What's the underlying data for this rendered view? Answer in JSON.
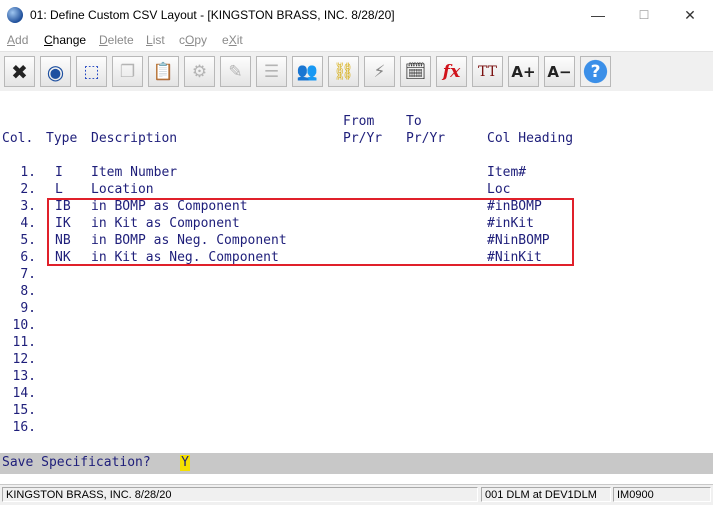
{
  "window": {
    "title": "01: Define Custom CSV Layout - [KINGSTON BRASS, INC. 8/28/20]",
    "minimize": "—",
    "maximize": "☐",
    "close": "✕"
  },
  "menu": [
    {
      "label": "Add",
      "active": false
    },
    {
      "label": "Change",
      "active": true
    },
    {
      "label": "Delete",
      "active": false
    },
    {
      "label": "List",
      "active": false
    },
    {
      "label": "cOpy",
      "active": false
    },
    {
      "label": "eXit",
      "active": false
    }
  ],
  "toolbar": [
    {
      "name": "exit-x-icon",
      "glyph": "✖"
    },
    {
      "name": "globe-icon",
      "glyph": "◉"
    },
    {
      "name": "select-box-icon",
      "glyph": "⬚"
    },
    {
      "name": "copy-icon",
      "glyph": "❐"
    },
    {
      "name": "paste-icon",
      "glyph": "📋"
    },
    {
      "name": "settings-gear-icon",
      "glyph": "⚙"
    },
    {
      "name": "edit-icon",
      "glyph": "✎"
    },
    {
      "name": "list-icon",
      "glyph": "☰"
    },
    {
      "name": "users-icon",
      "glyph": "👥"
    },
    {
      "name": "link-chain-icon",
      "glyph": "⛓"
    },
    {
      "name": "lightning-icon",
      "glyph": "⚡"
    },
    {
      "name": "calendar-edit-icon",
      "glyph": "🗓"
    },
    {
      "name": "function-fx-icon",
      "glyph": "fx"
    },
    {
      "name": "text-size-icon",
      "glyph": "TT"
    },
    {
      "name": "font-increase-icon",
      "glyph": "A+"
    },
    {
      "name": "font-decrease-icon",
      "glyph": "A−"
    },
    {
      "name": "help-icon",
      "glyph": "?"
    }
  ],
  "headers": {
    "from_top": "From",
    "to_top": "To",
    "col": "Col.",
    "type": "Type",
    "description": "Description",
    "from_bottom": "Pr/Yr",
    "to_bottom": "Pr/Yr",
    "col_heading": "Col Heading"
  },
  "rows": [
    {
      "num": "1.",
      "type": "I",
      "desc": "Item Number",
      "heading": "Item#"
    },
    {
      "num": "2.",
      "type": "L",
      "desc": "Location",
      "heading": "Loc"
    },
    {
      "num": "3.",
      "type": "IB",
      "desc": "in BOMP as Component",
      "heading": "#inBOMP"
    },
    {
      "num": "4.",
      "type": "IK",
      "desc": "in Kit as Component",
      "heading": "#inKit"
    },
    {
      "num": "5.",
      "type": "NB",
      "desc": "in BOMP as Neg. Component",
      "heading": "#NinBOMP"
    },
    {
      "num": "6.",
      "type": "NK",
      "desc": "in Kit as Neg. Component",
      "heading": "#NinKit"
    },
    {
      "num": "7.",
      "type": "",
      "desc": "",
      "heading": ""
    },
    {
      "num": "8.",
      "type": "",
      "desc": "",
      "heading": ""
    },
    {
      "num": "9.",
      "type": "",
      "desc": "",
      "heading": ""
    },
    {
      "num": "10.",
      "type": "",
      "desc": "",
      "heading": ""
    },
    {
      "num": "11.",
      "type": "",
      "desc": "",
      "heading": ""
    },
    {
      "num": "12.",
      "type": "",
      "desc": "",
      "heading": ""
    },
    {
      "num": "13.",
      "type": "",
      "desc": "",
      "heading": ""
    },
    {
      "num": "14.",
      "type": "",
      "desc": "",
      "heading": ""
    },
    {
      "num": "15.",
      "type": "",
      "desc": "",
      "heading": ""
    },
    {
      "num": "16.",
      "type": "",
      "desc": "",
      "heading": ""
    }
  ],
  "prompt": {
    "label": "Save Specification?",
    "value": "Y"
  },
  "status": {
    "company": "KINGSTON BRASS, INC. 8/28/20",
    "session": "001 DLM at DEV1DLM",
    "program": "IM0900"
  },
  "colors": {
    "highlight_box": "#e0202a",
    "terminal_text": "#1e1e7a",
    "cursor": "#f5e000"
  }
}
